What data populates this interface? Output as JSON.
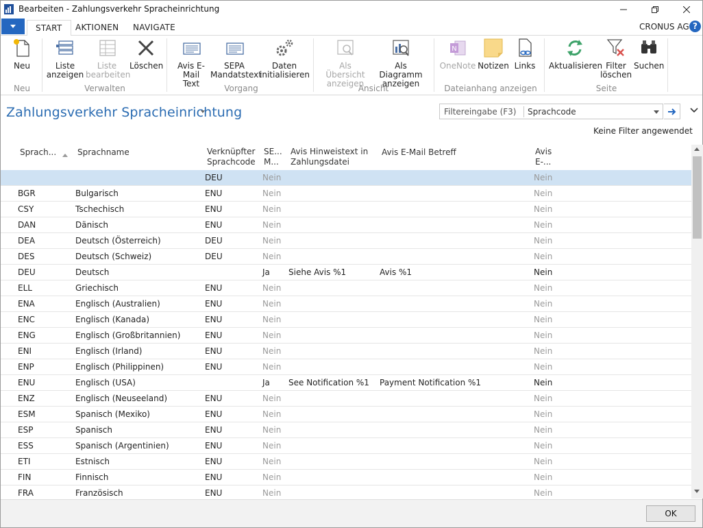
{
  "window": {
    "title": "Bearbeiten - Zahlungsverkehr Spracheinrichtung"
  },
  "tabs": [
    "START",
    "AKTIONEN",
    "NAVIGATE"
  ],
  "company": "CRONUS AG",
  "help": "?",
  "ribbon": {
    "buttons": {
      "neu": "Neu",
      "liste_anzeigen_1": "Liste",
      "liste_anzeigen_2": "anzeigen",
      "liste_bearbeiten_1": "Liste",
      "liste_bearbeiten_2": "bearbeiten",
      "loeschen": "Löschen",
      "avis_email_1": "Avis E-",
      "avis_email_2": "Mail Text",
      "sepa_1": "SEPA",
      "sepa_2": "Mandatstext",
      "daten_1": "Daten",
      "daten_2": "initialisieren",
      "uebersicht_1": "Als Übersicht",
      "uebersicht_2": "anzeigen",
      "diagramm_1": "Als Diagramm",
      "diagramm_2": "anzeigen",
      "onenote": "OneNote",
      "notizen": "Notizen",
      "links": "Links",
      "aktualisieren": "Aktualisieren",
      "filter_1": "Filter",
      "filter_2": "löschen",
      "suchen": "Suchen"
    },
    "groups": [
      "Neu",
      "Verwalten",
      "Vorgang",
      "Ansicht",
      "Dateianhang anzeigen",
      "Seite"
    ]
  },
  "page": {
    "title": "Zahlungsverkehr Spracheinrichtung"
  },
  "filter": {
    "label": "Filtereingabe (F3)",
    "value": "Sprachcode"
  },
  "no_filter": "Keine Filter angewendet",
  "columns": {
    "c1": "Sprach...",
    "c2": "Sprachname",
    "c3a": "Verknüpfter",
    "c3b": "Sprachcode",
    "c4a": "SE...",
    "c4b": "M...",
    "c5a": "Avis Hinweistext in",
    "c5b": "Zahlungsdatei",
    "c6": "Avis E-Mail Betreff",
    "c7a": "Avis",
    "c7b": "E-..."
  },
  "rows": [
    {
      "code": "",
      "name": "",
      "linked": "DEU",
      "sepa": "Nein",
      "hint": "",
      "subject": "",
      "avis": "Nein",
      "selected": true
    },
    {
      "code": "BGR",
      "name": "Bulgarisch",
      "linked": "ENU",
      "sepa": "Nein",
      "hint": "",
      "subject": "",
      "avis": "Nein"
    },
    {
      "code": "CSY",
      "name": "Tschechisch",
      "linked": "ENU",
      "sepa": "Nein",
      "hint": "",
      "subject": "",
      "avis": "Nein"
    },
    {
      "code": "DAN",
      "name": "Dänisch",
      "linked": "ENU",
      "sepa": "Nein",
      "hint": "",
      "subject": "",
      "avis": "Nein"
    },
    {
      "code": "DEA",
      "name": "Deutsch (Österreich)",
      "linked": "DEU",
      "sepa": "Nein",
      "hint": "",
      "subject": "",
      "avis": "Nein"
    },
    {
      "code": "DES",
      "name": "Deutsch (Schweiz)",
      "linked": "DEU",
      "sepa": "Nein",
      "hint": "",
      "subject": "",
      "avis": "Nein"
    },
    {
      "code": "DEU",
      "name": "Deutsch",
      "linked": "",
      "sepa": "Ja",
      "hint": "Siehe Avis %1",
      "subject": "Avis %1",
      "avis": "Nein"
    },
    {
      "code": "ELL",
      "name": "Griechisch",
      "linked": "ENU",
      "sepa": "Nein",
      "hint": "",
      "subject": "",
      "avis": "Nein"
    },
    {
      "code": "ENA",
      "name": "Englisch (Australien)",
      "linked": "ENU",
      "sepa": "Nein",
      "hint": "",
      "subject": "",
      "avis": "Nein"
    },
    {
      "code": "ENC",
      "name": "Englisch (Kanada)",
      "linked": "ENU",
      "sepa": "Nein",
      "hint": "",
      "subject": "",
      "avis": "Nein"
    },
    {
      "code": "ENG",
      "name": "Englisch (Großbritannien)",
      "linked": "ENU",
      "sepa": "Nein",
      "hint": "",
      "subject": "",
      "avis": "Nein"
    },
    {
      "code": "ENI",
      "name": "Englisch (Irland)",
      "linked": "ENU",
      "sepa": "Nein",
      "hint": "",
      "subject": "",
      "avis": "Nein"
    },
    {
      "code": "ENP",
      "name": "Englisch (Philippinen)",
      "linked": "ENU",
      "sepa": "Nein",
      "hint": "",
      "subject": "",
      "avis": "Nein"
    },
    {
      "code": "ENU",
      "name": "Englisch (USA)",
      "linked": "",
      "sepa": "Ja",
      "hint": "See Notification %1",
      "subject": "Payment Notification %1",
      "avis": "Nein"
    },
    {
      "code": "ENZ",
      "name": "Englisch (Neuseeland)",
      "linked": "ENU",
      "sepa": "Nein",
      "hint": "",
      "subject": "",
      "avis": "Nein"
    },
    {
      "code": "ESM",
      "name": "Spanisch (Mexiko)",
      "linked": "ENU",
      "sepa": "Nein",
      "hint": "",
      "subject": "",
      "avis": "Nein"
    },
    {
      "code": "ESP",
      "name": "Spanisch",
      "linked": "ENU",
      "sepa": "Nein",
      "hint": "",
      "subject": "",
      "avis": "Nein"
    },
    {
      "code": "ESS",
      "name": "Spanisch (Argentinien)",
      "linked": "ENU",
      "sepa": "Nein",
      "hint": "",
      "subject": "",
      "avis": "Nein"
    },
    {
      "code": "ETI",
      "name": "Estnisch",
      "linked": "ENU",
      "sepa": "Nein",
      "hint": "",
      "subject": "",
      "avis": "Nein"
    },
    {
      "code": "FIN",
      "name": "Finnisch",
      "linked": "ENU",
      "sepa": "Nein",
      "hint": "",
      "subject": "",
      "avis": "Nein"
    },
    {
      "code": "FRA",
      "name": "Französisch",
      "linked": "ENU",
      "sepa": "Nein",
      "hint": "",
      "subject": "",
      "avis": "Nein"
    }
  ],
  "footer": {
    "ok": "OK"
  },
  "colors": {
    "accent": "#2467c0",
    "title_blue": "#2b6cb2",
    "selected_row": "#cfe2f3"
  }
}
